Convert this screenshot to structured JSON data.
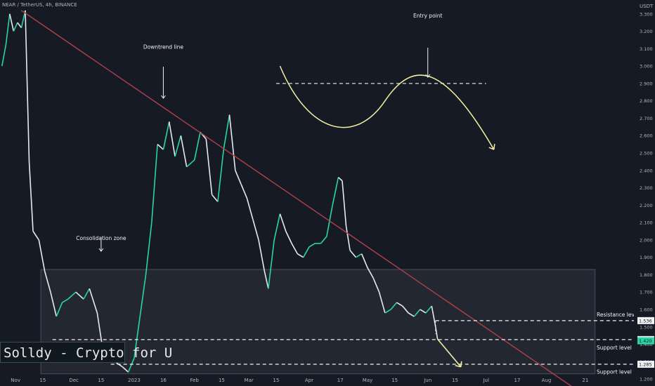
{
  "header": {
    "symbol_text": "NEAR / TetherUS, 4h, BINANCE"
  },
  "watermark": "Solldy - Crypto for U",
  "colors": {
    "background": "#161a25",
    "up": "#26d6a4",
    "down": "#e8ebe8",
    "trendline": "#b0404a",
    "annotation": "#f2f2a0",
    "dashed": "#f2f2f2",
    "box": "#3a3f4a"
  },
  "chart_data": {
    "type": "line",
    "series": [
      {
        "values": [
          {
            "x": "Oct 25",
            "y": 3.0
          },
          {
            "x": "Oct 27",
            "y": 3.12
          },
          {
            "x": "Oct 29",
            "y": 3.3
          },
          {
            "x": "Oct 31",
            "y": 3.2
          },
          {
            "x": "Nov 2",
            "y": 3.25
          },
          {
            "x": "Nov 4",
            "y": 3.22
          },
          {
            "x": "Nov 6",
            "y": 3.32
          },
          {
            "x": "Nov 8",
            "y": 2.45
          },
          {
            "x": "Nov 10",
            "y": 2.05
          },
          {
            "x": "Nov 13",
            "y": 2.0
          },
          {
            "x": "Nov 16",
            "y": 1.82
          },
          {
            "x": "Nov 19",
            "y": 1.7
          },
          {
            "x": "Nov 22",
            "y": 1.56
          },
          {
            "x": "Nov 25",
            "y": 1.64
          },
          {
            "x": "Nov 28",
            "y": 1.66
          },
          {
            "x": "Dec 2",
            "y": 1.7
          },
          {
            "x": "Dec 6",
            "y": 1.66
          },
          {
            "x": "Dec 9",
            "y": 1.72
          },
          {
            "x": "Dec 13",
            "y": 1.58
          },
          {
            "x": "Dec 16",
            "y": 1.36
          },
          {
            "x": "Dec 19",
            "y": 1.32
          },
          {
            "x": "Dec 22",
            "y": 1.3
          },
          {
            "x": "Dec 26",
            "y": 1.27
          },
          {
            "x": "Dec 29",
            "y": 1.24
          },
          {
            "x": "Jan 1",
            "y": 1.32
          },
          {
            "x": "Jan 4",
            "y": 1.56
          },
          {
            "x": "Jan 7",
            "y": 1.8
          },
          {
            "x": "Jan 10",
            "y": 2.1
          },
          {
            "x": "Jan 13",
            "y": 2.55
          },
          {
            "x": "Jan 16",
            "y": 2.52
          },
          {
            "x": "Jan 19",
            "y": 2.68
          },
          {
            "x": "Jan 22",
            "y": 2.48
          },
          {
            "x": "Jan 25",
            "y": 2.6
          },
          {
            "x": "Jan 28",
            "y": 2.42
          },
          {
            "x": "Feb 1",
            "y": 2.46
          },
          {
            "x": "Feb 4",
            "y": 2.62
          },
          {
            "x": "Feb 7",
            "y": 2.58
          },
          {
            "x": "Feb 10",
            "y": 2.26
          },
          {
            "x": "Feb 13",
            "y": 2.22
          },
          {
            "x": "Feb 16",
            "y": 2.52
          },
          {
            "x": "Feb 19",
            "y": 2.72
          },
          {
            "x": "Feb 22",
            "y": 2.4
          },
          {
            "x": "Feb 25",
            "y": 2.32
          },
          {
            "x": "Feb 28",
            "y": 2.24
          },
          {
            "x": "Mar 3",
            "y": 2.12
          },
          {
            "x": "Mar 6",
            "y": 2.0
          },
          {
            "x": "Mar 9",
            "y": 1.82
          },
          {
            "x": "Mar 11",
            "y": 1.72
          },
          {
            "x": "Mar 14",
            "y": 2.0
          },
          {
            "x": "Mar 17",
            "y": 2.15
          },
          {
            "x": "Mar 20",
            "y": 2.05
          },
          {
            "x": "Mar 23",
            "y": 1.98
          },
          {
            "x": "Mar 26",
            "y": 1.92
          },
          {
            "x": "Mar 29",
            "y": 1.9
          },
          {
            "x": "Apr 1",
            "y": 1.96
          },
          {
            "x": "Apr 4",
            "y": 1.98
          },
          {
            "x": "Apr 7",
            "y": 1.98
          },
          {
            "x": "Apr 10",
            "y": 2.02
          },
          {
            "x": "Apr 13",
            "y": 2.2
          },
          {
            "x": "Apr 16",
            "y": 2.36
          },
          {
            "x": "Apr 18",
            "y": 2.34
          },
          {
            "x": "Apr 20",
            "y": 2.08
          },
          {
            "x": "Apr 22",
            "y": 1.94
          },
          {
            "x": "Apr 25",
            "y": 1.9
          },
          {
            "x": "Apr 28",
            "y": 1.92
          },
          {
            "x": "May 1",
            "y": 1.84
          },
          {
            "x": "May 4",
            "y": 1.78
          },
          {
            "x": "May 7",
            "y": 1.7
          },
          {
            "x": "May 10",
            "y": 1.58
          },
          {
            "x": "May 13",
            "y": 1.6
          },
          {
            "x": "May 16",
            "y": 1.64
          },
          {
            "x": "May 19",
            "y": 1.62
          },
          {
            "x": "May 22",
            "y": 1.58
          },
          {
            "x": "May 25",
            "y": 1.56
          },
          {
            "x": "May 28",
            "y": 1.6
          },
          {
            "x": "May 31",
            "y": 1.58
          },
          {
            "x": "Jun 3",
            "y": 1.62
          },
          {
            "x": "Jun 5",
            "y": 1.5
          },
          {
            "x": "Jun 6",
            "y": 1.43
          }
        ]
      }
    ],
    "x_ticks": [
      "Nov",
      "15",
      "Dec",
      "15",
      "2023",
      "16",
      "Feb",
      "15",
      "Mar",
      "15",
      "Apr",
      "17",
      "May",
      "15",
      "Jun",
      "15",
      "Jul",
      "17",
      "Aug",
      "21"
    ],
    "x_tick_dates": [
      "Nov 1",
      "Nov 15",
      "Dec 1",
      "Dec 15",
      "Jan 1",
      "Jan 16",
      "Feb 1",
      "Feb 15",
      "Mar 1",
      "Mar 15",
      "Apr 1",
      "Apr 17",
      "May 1",
      "May 15",
      "Jun 1",
      "Jun 15",
      "Jul 1",
      "Jul 17",
      "Aug 1",
      "Aug 21"
    ],
    "y_axis": {
      "unit": "USDT",
      "ticks": [
        "1.200",
        "1.300",
        "1.400",
        "1.500",
        "1.600",
        "1.700",
        "1.800",
        "1.900",
        "2.000",
        "2.100",
        "2.200",
        "2.300",
        "2.400",
        "2.500",
        "2.600",
        "2.700",
        "2.800",
        "2.900",
        "3.000",
        "3.100",
        "3.200",
        "3.300"
      ],
      "ylim": [
        1.16,
        3.38
      ]
    },
    "x_range": [
      "Oct 24",
      "Sep 15"
    ],
    "price_labels": [
      {
        "label": "1.536",
        "y": 1.536,
        "color": "#f2f2f2"
      },
      {
        "label": "1.427",
        "y": 1.427,
        "color": "#f2f2f2"
      },
      {
        "label": "1.420",
        "y": 1.42,
        "color": "#26d6a4"
      },
      {
        "label": "1.285",
        "y": 1.285,
        "color": "#f2f2f2"
      }
    ],
    "horizontal_levels": [
      {
        "y": 1.536,
        "x_start": "Jun 5",
        "x_end": "Sep 15"
      },
      {
        "y": 1.427,
        "x_start": "Nov 20",
        "x_end": "Sep 15"
      },
      {
        "y": 1.285,
        "x_start": "Dec 20",
        "x_end": "Sep 15"
      },
      {
        "y": 2.9,
        "x_start": "Mar 15",
        "x_end": "Jul 1"
      }
    ],
    "annotations": [
      {
        "text": "Entry point",
        "x": "Jun 1",
        "y": 3.28
      },
      {
        "text": "Downtrend line",
        "x": "Jan 16",
        "y": 3.1
      },
      {
        "text": "Consolidation zone",
        "x": "Dec 15",
        "y": 2.0
      },
      {
        "text": "Resistance level",
        "x": "Aug 21",
        "y": 1.56
      },
      {
        "text": "Support level",
        "x": "Aug 21",
        "y": 1.37
      },
      {
        "text": "Support level",
        "x": "Aug 21",
        "y": 1.23
      }
    ],
    "consolidation_box": {
      "x_start": "Nov 14",
      "x_end": "Aug 26",
      "y_low": 1.23,
      "y_high": 1.83
    },
    "trendline": {
      "start": {
        "x": "Nov 4",
        "y": 3.32
      },
      "end": {
        "x": "Aug 15",
        "y": 1.15
      }
    },
    "grid": false
  }
}
